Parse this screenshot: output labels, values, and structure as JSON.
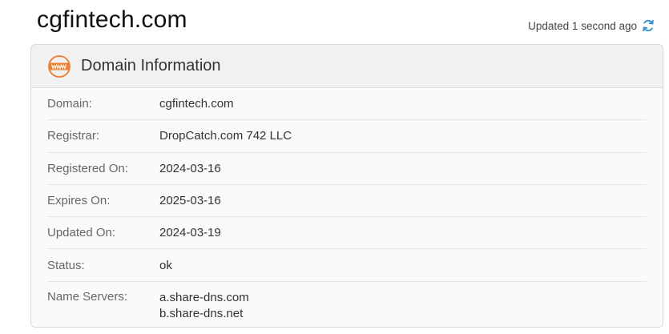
{
  "page": {
    "domain_title": "cgfintech.com",
    "updated_text": "Updated 1 second ago"
  },
  "panel": {
    "title": "Domain Information",
    "icon": "www-icon",
    "rows": [
      {
        "label": "Domain:",
        "value": "cgfintech.com"
      },
      {
        "label": "Registrar:",
        "value": "DropCatch.com 742 LLC"
      },
      {
        "label": "Registered On:",
        "value": "2024-03-16"
      },
      {
        "label": "Expires On:",
        "value": "2025-03-16"
      },
      {
        "label": "Updated On:",
        "value": "2024-03-19"
      },
      {
        "label": "Status:",
        "value": "ok"
      }
    ],
    "name_servers": {
      "label": "Name Servers:",
      "values": [
        "a.share-dns.com",
        "b.share-dns.net"
      ]
    }
  },
  "colors": {
    "accent_orange": "#f07e2e",
    "refresh_blue": "#2b8fd6"
  }
}
